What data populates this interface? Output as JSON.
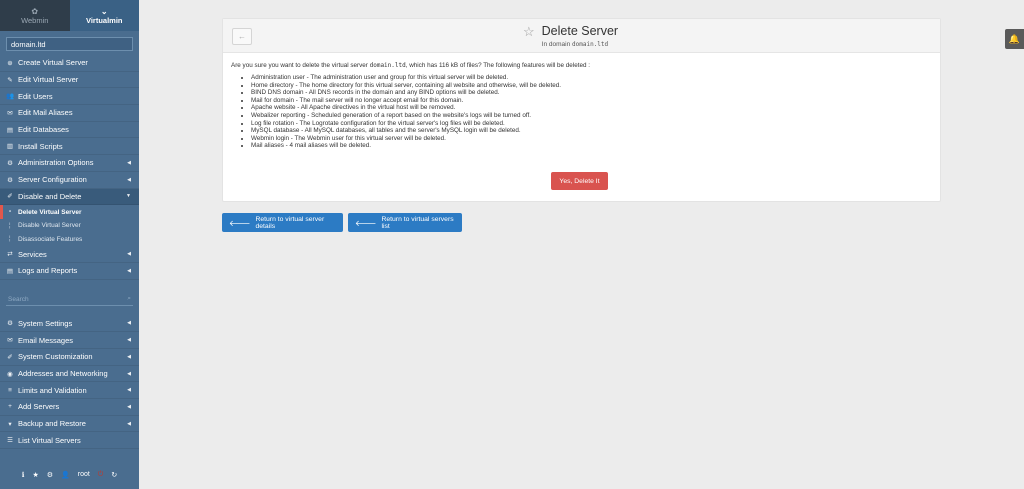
{
  "switcher": {
    "webmin_label": "Webmin",
    "virtualmin_label": "Virtualmin"
  },
  "domain": {
    "selected": "domain.ltd"
  },
  "nav": {
    "items": [
      {
        "label": "Create Virtual Server",
        "icon": "plus-circle"
      },
      {
        "label": "Edit Virtual Server",
        "icon": "pencil-square"
      },
      {
        "label": "Edit Users",
        "icon": "users"
      },
      {
        "label": "Edit Mail Aliases",
        "icon": "envelope"
      },
      {
        "label": "Edit Databases",
        "icon": "database"
      },
      {
        "label": "Install Scripts",
        "icon": "file-code"
      },
      {
        "label": "Administration Options",
        "icon": "gear"
      },
      {
        "label": "Server Configuration",
        "icon": "gears"
      },
      {
        "label": "Disable and Delete",
        "icon": "wrench"
      }
    ],
    "sub_items": [
      {
        "label": "Delete Virtual Server"
      },
      {
        "label": "Disable Virtual Server"
      },
      {
        "label": "Disassociate Features"
      }
    ],
    "items2": [
      {
        "label": "Services",
        "icon": "share"
      },
      {
        "label": "Logs and Reports",
        "icon": "file-text"
      }
    ],
    "search_placeholder": "Search",
    "items3": [
      {
        "label": "System Settings",
        "icon": "gear"
      },
      {
        "label": "Email Messages",
        "icon": "envelope"
      },
      {
        "label": "System Customization",
        "icon": "wrench"
      },
      {
        "label": "Addresses and Networking",
        "icon": "globe"
      },
      {
        "label": "Limits and Validation",
        "icon": "sliders"
      },
      {
        "label": "Add Servers",
        "icon": "plus"
      },
      {
        "label": "Backup and Restore",
        "icon": "download"
      },
      {
        "label": "List Virtual Servers",
        "icon": "list"
      }
    ]
  },
  "bottom": {
    "user": "root"
  },
  "page": {
    "title": "Delete Server",
    "subtitle_prefix": "In domain",
    "subtitle_domain": "domain.ltd",
    "intro_prefix": "Are you sure you want to delete the virtual server",
    "intro_domain": "domain.ltd",
    "intro_suffix": ", which has 116 kB of files? The following features will be deleted :",
    "features": [
      "Administration user - The administration user and group for this virtual server will be deleted.",
      "Home directory - The home directory for this virtual server, containing all website and otherwise, will be deleted.",
      "BIND DNS domain - All DNS records in the domain and any BIND options will be deleted.",
      "Mail for domain - The mail server will no longer accept email for this domain.",
      "Apache website - All Apache directives in the virtual host will be removed.",
      "Webalizer reporting - Scheduled generation of a report based on the website's logs will be turned off.",
      "Log file rotation - The Logrotate configuration for the virtual server's log files will be deleted.",
      "MySQL database - All MySQL databases, all tables and the server's MySQL login will be deleted.",
      "Webmin login - The Webmin user for this virtual server will be deleted.",
      "Mail aliases - 4 mail aliases will be deleted."
    ],
    "delete_button": "Yes, Delete It",
    "return_details": "Return to virtual server details",
    "return_list": "Return to virtual servers list"
  },
  "colors": {
    "sidebar": "#4a6d8f",
    "danger": "#d9534f",
    "primary": "#2c7bc4"
  }
}
